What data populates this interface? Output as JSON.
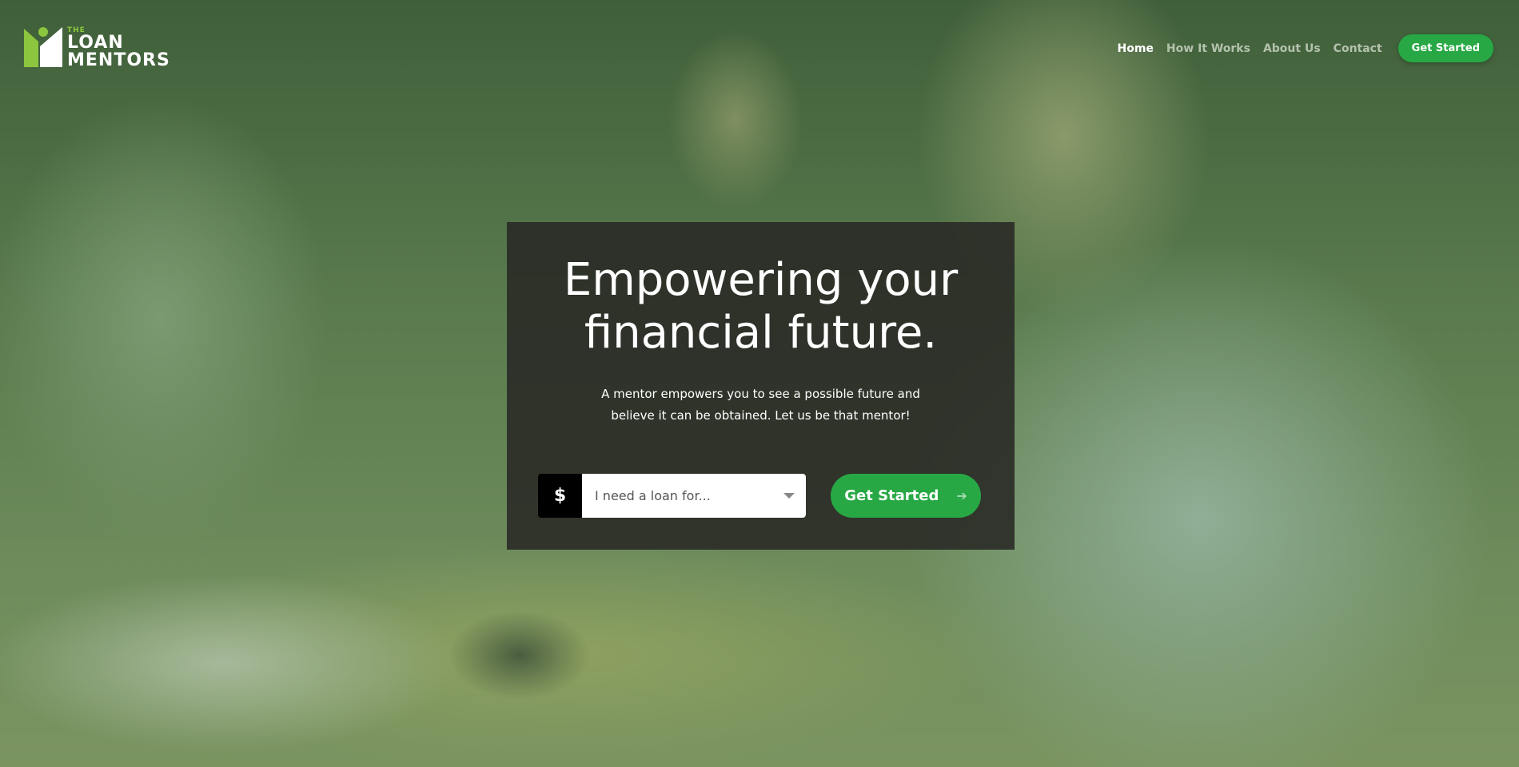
{
  "brand": {
    "the": "THE",
    "line1": "LOAN",
    "line2": "MENTORS",
    "logo_colors": {
      "green": "#8cc63f",
      "white": "#ffffff"
    }
  },
  "nav": {
    "items": [
      {
        "label": "Home",
        "active": true
      },
      {
        "label": "How It Works"
      },
      {
        "label": "About Us"
      },
      {
        "label": "Contact"
      }
    ],
    "cta": "Get Started"
  },
  "hero": {
    "title_line1": "Empowering your",
    "title_line2": "financial future.",
    "subtitle_line1": "A mentor empowers you to see a possible future and",
    "subtitle_line2": "believe it can be obtained. Let us be that mentor!",
    "currency_symbol": "$",
    "select_placeholder": "I need a loan for...",
    "cta": "Get Started",
    "cta_icon": "arrow-right-icon"
  },
  "colors": {
    "accent": "#27a844",
    "panel": "#282824"
  }
}
